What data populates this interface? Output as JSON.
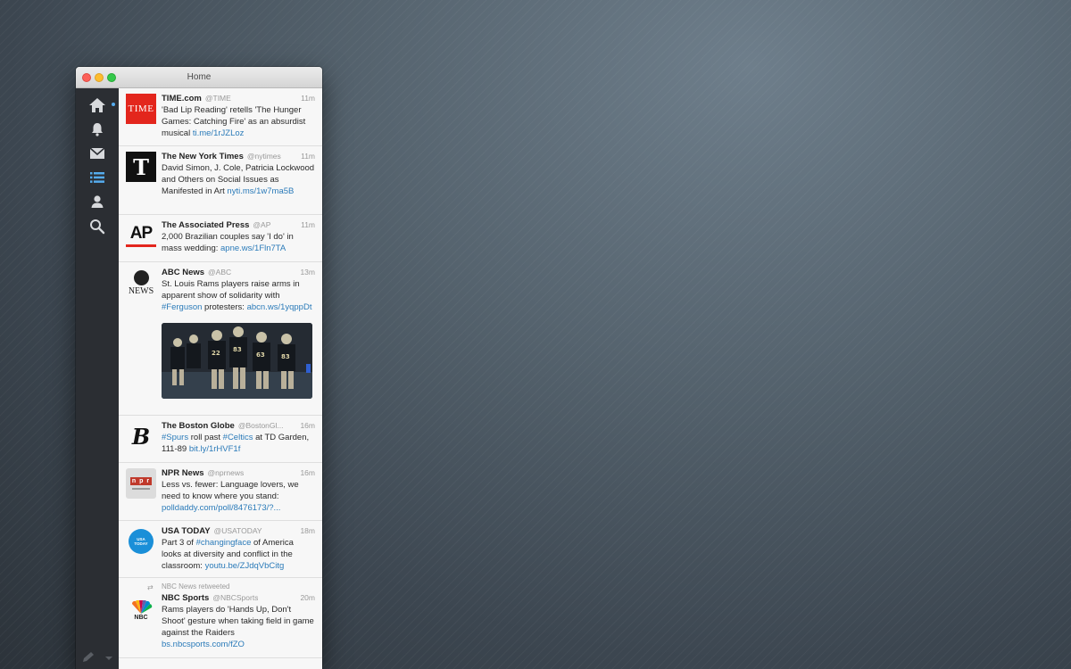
{
  "window": {
    "title": "Home"
  },
  "colors": {
    "accent": "#55acee",
    "link": "#2b7bb9",
    "sidebar": "#2b2e33"
  },
  "sidebar": {
    "items": [
      {
        "name": "home-icon",
        "active": false
      },
      {
        "name": "notifications-icon",
        "active": false
      },
      {
        "name": "messages-icon",
        "active": false
      },
      {
        "name": "lists-icon",
        "active": true
      },
      {
        "name": "profile-icon",
        "active": false
      },
      {
        "name": "search-icon",
        "active": false
      }
    ],
    "footer_icons": [
      "compose-icon",
      "chevron-down-icon"
    ]
  },
  "tweets": [
    {
      "author": "TIME.com",
      "handle": "@TIME",
      "time": "11m",
      "avatar_text": "TIME",
      "text_before": "'Bad Lip Reading' retells 'The Hunger Games: Catching Fire' as an absurdist musical ",
      "link": "ti.me/1rJZLoz",
      "text_after": ""
    },
    {
      "author": "The New York Times",
      "handle": "@nytimes",
      "time": "11m",
      "avatar_text": "T",
      "text_before": "David Simon, J. Cole, Patricia Lockwood and Others on Social Issues as Manifested in Art ",
      "link": "nyti.ms/1w7ma5B",
      "text_after": ""
    },
    {
      "author": "The Associated Press",
      "handle": "@AP",
      "time": "11m",
      "avatar_text": "AP",
      "text_before": "2,000 Brazilian couples say 'I do' in mass wedding: ",
      "link": "apne.ws/1Fln7TA",
      "text_after": ""
    },
    {
      "author": "ABC News",
      "handle": "@ABC",
      "time": "13m",
      "avatar_text": "NEWS",
      "text_before": "St. Louis Rams players raise arms in apparent show of solidarity with ",
      "hashtag": "#Ferguson",
      "text_mid": " protesters: ",
      "link": "abcn.ws/1yqppDt",
      "text_after": ""
    },
    {
      "author": "The Boston Globe",
      "handle": "@BostonGl...",
      "time": "16m",
      "avatar_text": "B",
      "hashtag1": "#Spurs",
      "text1": " roll past ",
      "hashtag2": "#Celtics",
      "text2": " at TD Garden, 111-89 ",
      "link": "bit.ly/1rHVF1f"
    },
    {
      "author": "NPR News",
      "handle": "@nprnews",
      "time": "16m",
      "avatar_text": "n p r",
      "text_before": "Less vs. fewer: Language lovers, we need to know where you stand: ",
      "link": "polldaddy.com/poll/8476173/?...",
      "text_after": ""
    },
    {
      "author": "USA TODAY",
      "handle": "@USATODAY",
      "time": "18m",
      "avatar_text": "USA TODAY",
      "text_before": "Part 3 of ",
      "hashtag": "#changingface",
      "text_mid": " of America looks at diversity and conflict in the classroom: ",
      "link": "youtu.be/ZJdqVbCitg"
    },
    {
      "retweet_by": "NBC News retweeted",
      "author": "NBC Sports",
      "handle": "@NBCSports",
      "time": "20m",
      "avatar_text": "NBC",
      "text_before": "Rams players do 'Hands Up, Don't Shoot' gesture when taking field in game against the Raiders ",
      "link": "bs.nbcsports.com/fZO"
    }
  ]
}
